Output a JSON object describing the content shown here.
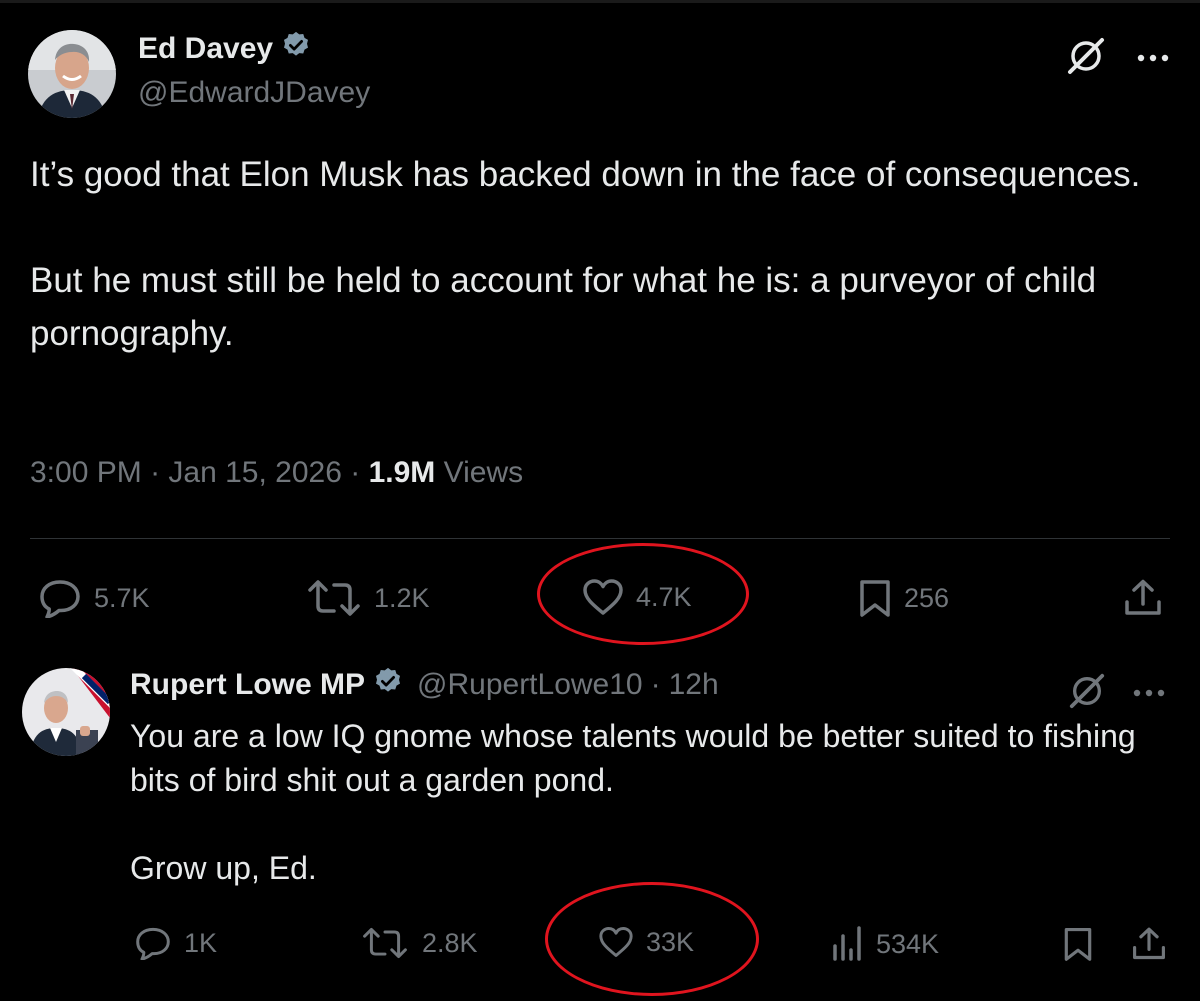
{
  "main_tweet": {
    "author_name": "Ed Davey",
    "verified": true,
    "handle": "@EdwardJDavey",
    "paragraphs": [
      "It’s good that Elon Musk has backed down in the face of consequences.",
      "But he must still be held to account for what he is: a purveyor of child pornography."
    ],
    "time": "3:00 PM",
    "separator": "·",
    "date": "Jan 15, 2026",
    "views_count": "1.9M",
    "views_label": "Views",
    "actions": {
      "replies": "5.7K",
      "reposts": "1.2K",
      "likes": "4.7K",
      "bookmarks": "256"
    }
  },
  "reply_tweet": {
    "author_name": "Rupert Lowe MP",
    "verified": true,
    "handle": "@RupertLowe10",
    "separator": "·",
    "time": "12h",
    "paragraphs": [
      "You are a low IQ gnome whose talents would be better suited to fishing bits of bird shit out a garden pond.",
      "Grow up, Ed."
    ],
    "actions": {
      "replies": "1K",
      "reposts": "2.8K",
      "likes": "33K",
      "views": "534K"
    }
  },
  "annotations": {
    "highlight_color": "#e0141e",
    "highlighted": [
      "main_tweet.actions.likes",
      "reply_tweet.actions.likes"
    ]
  },
  "colors": {
    "background": "#000000",
    "text_primary": "#e7e9ea",
    "text_secondary": "#71767b",
    "verified_badge": "#829aab",
    "divider": "#2f3336"
  }
}
